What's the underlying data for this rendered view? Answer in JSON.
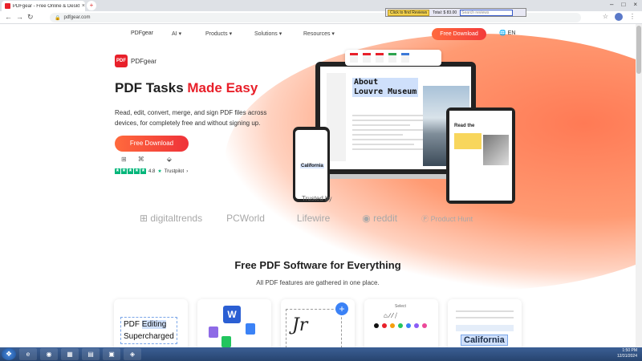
{
  "browser": {
    "tab_title": "PDFgear - Free Online & Desktop PDF Editor",
    "new_tab": "+",
    "url": "pdfgear.com",
    "window_controls": [
      "–",
      "□",
      "×"
    ],
    "extension": {
      "button": "Click to find Reviews",
      "label": "Total: $ 83.00",
      "input_placeholder": "Search reviews"
    }
  },
  "nav": {
    "logo": "PDFgear",
    "items": [
      "AI",
      "Products",
      "Solutions",
      "Resources"
    ],
    "cta": "Free Download",
    "lang": "EN"
  },
  "hero": {
    "brand": "PDFgear",
    "title_plain": "PDF Tasks ",
    "title_accent": "Made Easy",
    "description": "Read, edit, convert, merge, and sign PDF files across devices, for completely free and without signing up.",
    "cta": "Free Download",
    "platform_icons": [
      "windows-icon",
      "mac-icon",
      "apple-icon",
      "android-icon"
    ],
    "rating_value": "4.8",
    "rating_source": "Trustpilot",
    "rating_arrow": "›",
    "devices": {
      "laptop_heading_line1": "About",
      "laptop_heading_line2": "Louvre Museum",
      "phone_label": "California",
      "tablet_label": "Read the"
    }
  },
  "trusted": {
    "label": "Trusted by",
    "logos": [
      "digitaltrends",
      "PCWorld",
      "Lifewire",
      "reddit",
      "Product Hunt"
    ]
  },
  "features": {
    "title": "Free PDF Software for Everything",
    "subtitle": "All PDF features are gathered in one place.",
    "card1_line1_a": "PDF ",
    "card1_line1_b": "Editing",
    "card1_line2": "Supercharged",
    "card2_icon": "W",
    "card3_badge": "+",
    "card3_signature": "Jr",
    "card4_label": "Select",
    "card5_label": "California",
    "palette": [
      "#111111",
      "#e8202a",
      "#f59e0b",
      "#22c55e",
      "#3b82f6",
      "#8b5cf6",
      "#ec4899"
    ]
  },
  "taskbar": {
    "start": "❖",
    "items": [
      "e",
      "◉",
      "▦",
      "▤",
      "▣",
      "◈"
    ],
    "time": "1:50 PM",
    "date": "12/31/2024"
  }
}
